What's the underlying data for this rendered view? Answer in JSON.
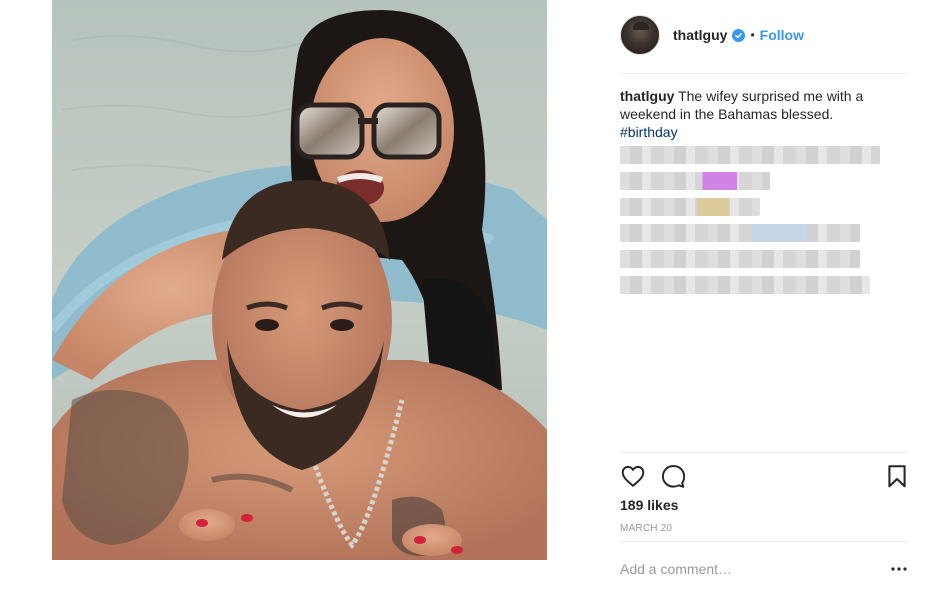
{
  "post": {
    "photo_alt": "selfie of a man and a woman in sunglasses in the water",
    "photo_colors": {
      "water": "#c2ccc5",
      "float_ring": "#7fb6cf",
      "skin": "#c9896a",
      "hair": "#1c1614"
    }
  },
  "header": {
    "username": "thatlguy",
    "verified_icon": "verified-badge-icon",
    "separator": "•",
    "follow_label": "Follow"
  },
  "caption": {
    "username": "thatlguy",
    "text": "The wifey surprised me with a weekend in the Bahamas blessed.",
    "hashtag": "#birthday"
  },
  "comments_blurred": [
    {
      "width": 260,
      "accent": null
    },
    {
      "width": 150,
      "accent": "#c86ee0"
    },
    {
      "width": 140,
      "accent": "#d8c38a"
    },
    {
      "width": 240,
      "accent": "#bcd0e6"
    },
    {
      "width": 240,
      "accent": null
    },
    {
      "width": 250,
      "accent": null
    }
  ],
  "actions": {
    "like_icon": "heart-icon",
    "comment_icon": "comment-bubble-icon",
    "save_icon": "bookmark-icon"
  },
  "likes_label": "189 likes",
  "date_label": "MARCH 20",
  "comment_input": {
    "placeholder": "Add a comment…",
    "value": ""
  },
  "more_icon": "more-options-icon",
  "colors": {
    "accent_blue": "#3897f0",
    "hashtag": "#003569",
    "text": "#262626",
    "muted": "#999999",
    "divider": "#efefef"
  }
}
